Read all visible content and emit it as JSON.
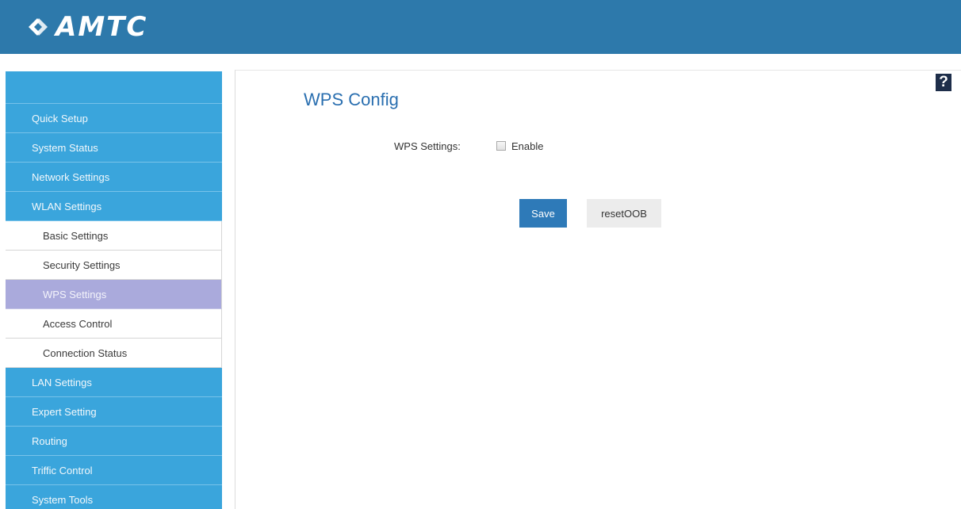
{
  "header": {
    "logo_text": "AMTC",
    "logo_icon": "amtc-logo-mark",
    "bg_color": "#2d79ab"
  },
  "help": {
    "label": "?"
  },
  "sidebar": {
    "items": [
      {
        "label": "Quick Setup",
        "type": "main"
      },
      {
        "label": "System Status",
        "type": "main"
      },
      {
        "label": "Network Settings",
        "type": "main"
      },
      {
        "label": "WLAN Settings",
        "type": "main"
      },
      {
        "label": "Basic Settings",
        "type": "sub"
      },
      {
        "label": "Security Settings",
        "type": "sub"
      },
      {
        "label": "WPS Settings",
        "type": "sub",
        "active": true
      },
      {
        "label": "Access Control",
        "type": "sub"
      },
      {
        "label": "Connection Status",
        "type": "sub"
      },
      {
        "label": "LAN Settings",
        "type": "main"
      },
      {
        "label": "Expert Setting",
        "type": "main"
      },
      {
        "label": "Routing",
        "type": "main"
      },
      {
        "label": "Triffic Control",
        "type": "main"
      },
      {
        "label": "System Tools",
        "type": "main"
      }
    ]
  },
  "main": {
    "title": "WPS Config",
    "wps_settings_label": "WPS Settings:",
    "enable_label": "Enable",
    "enable_checked": false,
    "save_label": "Save",
    "reset_label": "resetOOB"
  },
  "colors": {
    "accent": "#2e7ab8",
    "sidebar": "#3aa5dc",
    "active_item": "#aaaadc",
    "title": "#2a6fb0"
  }
}
